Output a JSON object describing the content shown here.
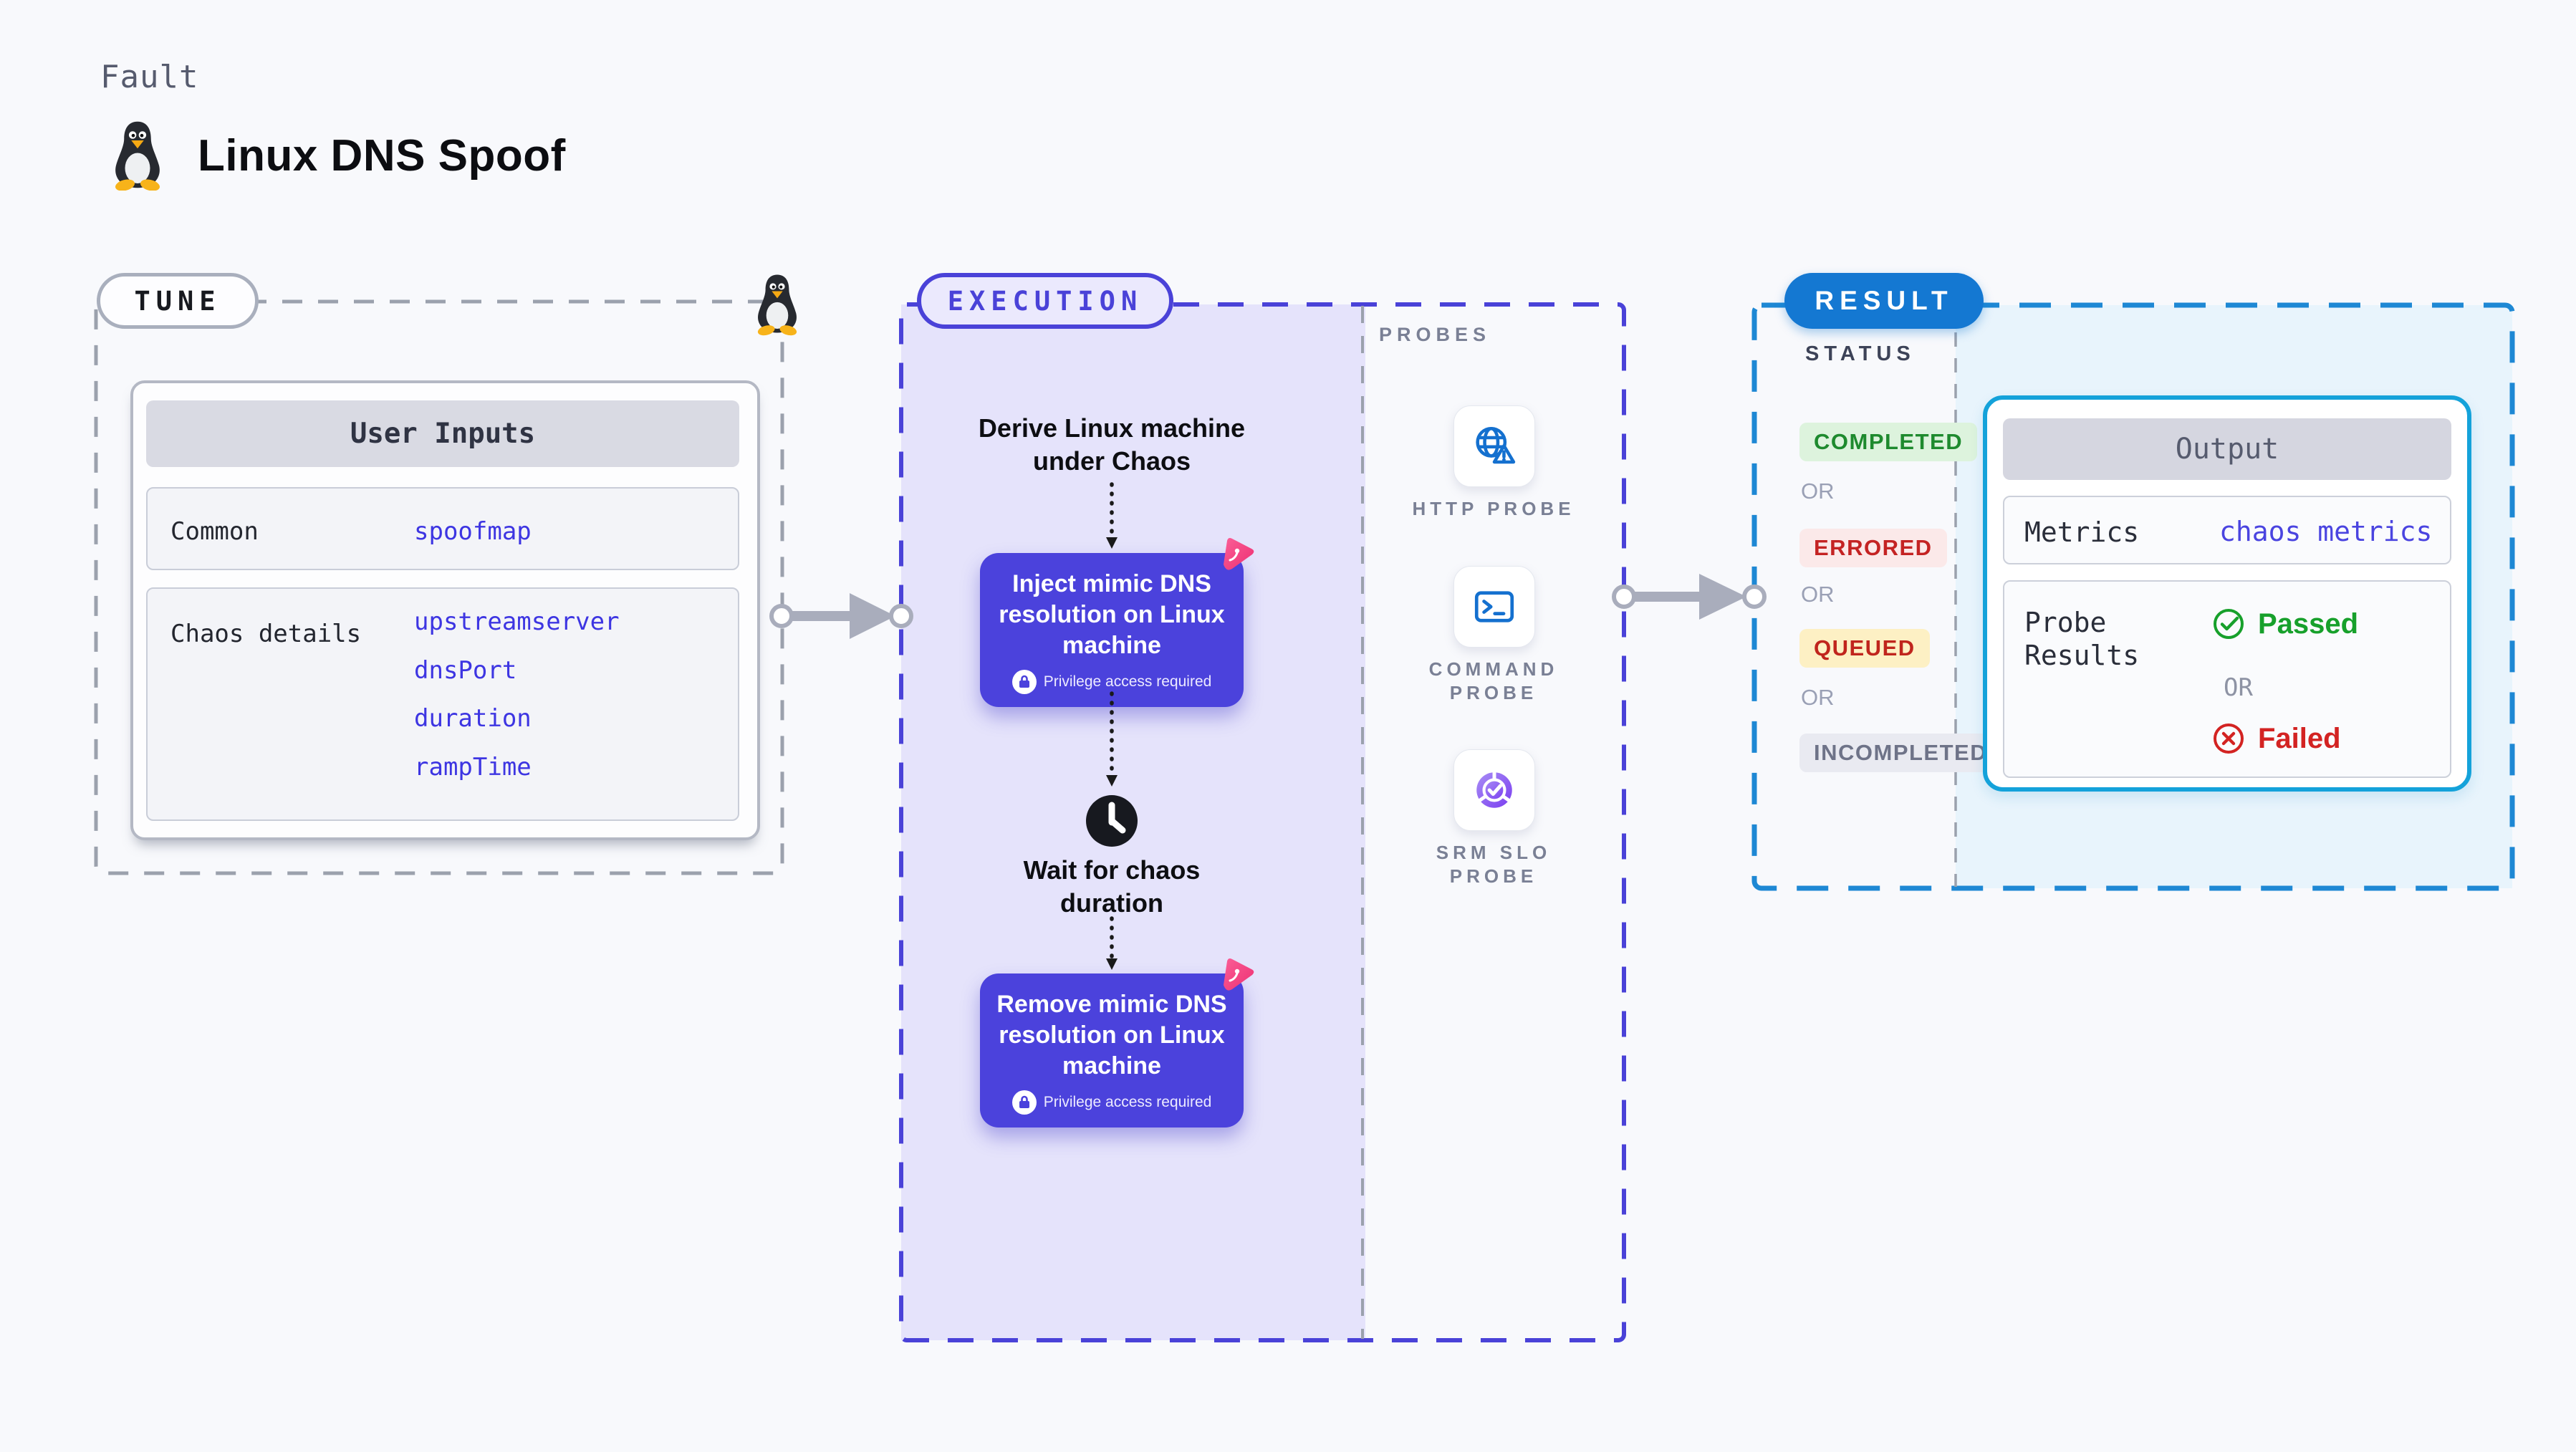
{
  "header": {
    "kicker": "Fault",
    "title": "Linux DNS Spoof"
  },
  "tune": {
    "label": "TUNE",
    "table": {
      "header": "User Inputs",
      "rows": [
        {
          "label": "Common",
          "values": [
            "spoofmap"
          ]
        },
        {
          "label": "Chaos details",
          "values": [
            "upstreamserver",
            "dnsPort",
            "duration",
            "rampTime"
          ]
        }
      ]
    }
  },
  "execution": {
    "label": "EXECUTION",
    "derive_line1": "Derive Linux machine",
    "derive_line2": "under Chaos",
    "inject": {
      "title": "Inject mimic DNS resolution on Linux machine",
      "badge": "Privilege access required"
    },
    "wait_line1": "Wait for chaos",
    "wait_line2": "duration",
    "remove": {
      "title": "Remove mimic DNS resolution on Linux machine",
      "badge": "Privilege access required"
    }
  },
  "probes": {
    "label": "PROBES",
    "items": [
      {
        "name": "HTTP PROBE",
        "icon": "globe-warning-icon"
      },
      {
        "name": "COMMAND PROBE",
        "icon": "terminal-icon"
      },
      {
        "name": "SRM SLO PROBE",
        "icon": "slo-donut-check-icon"
      }
    ]
  },
  "result": {
    "label": "RESULT",
    "status_label": "STATUS",
    "or": "OR",
    "statuses": [
      "COMPLETED",
      "ERRORED",
      "QUEUED",
      "INCOMPLETED"
    ],
    "output": {
      "header": "Output",
      "metrics_label": "Metrics",
      "metrics_value": "chaos metrics",
      "probe_label": "Probe Results",
      "passed": "Passed",
      "or": "OR",
      "failed": "Failed"
    }
  },
  "colors": {
    "indigo": "#4a42d8",
    "node_indigo": "#4b42dc",
    "lavender_bg": "#e5e3fb",
    "result_blue": "#1478d2",
    "result_dash_blue": "#1e88d4",
    "output_cyan": "#14a2da",
    "output_panel_blue": "#e8f4fc",
    "probe_icon_blue": "#1470cf",
    "value_blue": "#3d35e2",
    "green": "#1e8a2e",
    "red": "#c42323",
    "amber_bg": "#fdf0c4",
    "gray_dash": "#9ba1ad",
    "arrow_gray": "#a9adbc",
    "litmus_pink": "#f43f7f"
  }
}
